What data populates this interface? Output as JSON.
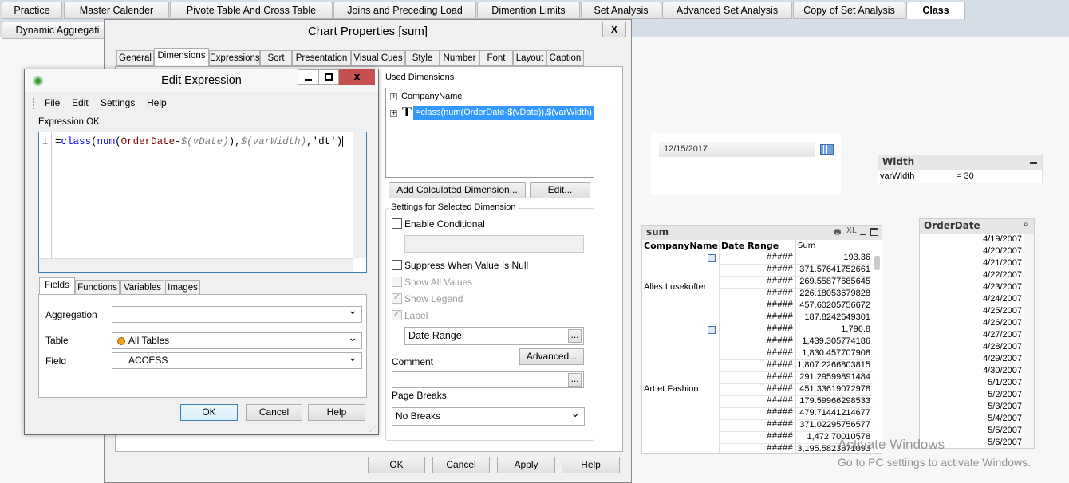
{
  "sheet_tabs": [
    "Practice",
    "Master Calender",
    "Pivote Table And Cross Table",
    "Joins and Preceding Load",
    "Dimention Limits",
    "Set Analysis",
    "Advanced Set Analysis",
    "Copy of Set Analysis",
    "Class"
  ],
  "sheet_tabs_row2": [
    "Dynamic Aggregati"
  ],
  "active_tab": "Class",
  "chart_properties": {
    "title": "Chart Properties [sum]",
    "close": "X",
    "tabs": [
      "General",
      "Dimensions",
      "Expressions",
      "Sort",
      "Presentation",
      "Visual Cues",
      "Style",
      "Number",
      "Font",
      "Layout",
      "Caption"
    ],
    "active_tab": "Dimensions",
    "used_dimensions_label": "Used Dimensions",
    "dimensions": [
      "CompanyName",
      "=class(num(OrderDate-$(vDate)),$(varWidth)"
    ],
    "add_calc_button": "Add Calculated Dimension...",
    "edit_button": "Edit...",
    "settings_group": "Settings for Selected Dimension",
    "enable_conditional": "Enable Conditional",
    "suppress_null": "Suppress When Value Is Null",
    "show_all_values": "Show All Values",
    "show_legend": "Show Legend",
    "label": "Label",
    "label_value": "Date Range",
    "ellipsis": "...",
    "advanced_button": "Advanced...",
    "comment_label": "Comment",
    "page_breaks_label": "Page Breaks",
    "page_breaks_value": "No Breaks",
    "ok": "OK",
    "cancel": "Cancel",
    "apply": "Apply",
    "help": "Help"
  },
  "edit_expression": {
    "title": "Edit Expression",
    "menu": [
      "File",
      "Edit",
      "Settings",
      "Help"
    ],
    "status": "Expression OK",
    "line_number": "1",
    "expression_parts": {
      "p1": "=",
      "p2": "class",
      "p3": "(",
      "p4": "num",
      "p5": "(",
      "p6": "OrderDate",
      "p7": "-",
      "p8": "$(vDate)",
      "p9": "),",
      "p10": "$(varWidth)",
      "p11": ",",
      "p12": "'dt'",
      "p13": ")"
    },
    "tabs": [
      "Fields",
      "Functions",
      "Variables",
      "Images"
    ],
    "aggregation_label": "Aggregation",
    "aggregation_value": "",
    "table_label": "Table",
    "table_value": "All Tables",
    "field_label": "Field",
    "field_value": "ACCESS",
    "ok": "OK",
    "cancel": "Cancel",
    "help": "Help"
  },
  "date_input": {
    "value": "12/15/2017"
  },
  "width_box": {
    "title": "Width",
    "var_name": "varWidth",
    "var_value": "= 30"
  },
  "sum_table": {
    "title": "sum",
    "xl": "XL",
    "columns": [
      "CompanyName",
      "Date Range",
      "Sum"
    ],
    "groups": [
      {
        "company": "Alles Lusekofter",
        "rows": [
          [
            "#####",
            "193.36"
          ],
          [
            "#####",
            "371.57641752661"
          ],
          [
            "#####",
            "269.55877685645"
          ],
          [
            "#####",
            "226.18053679828"
          ],
          [
            "#####",
            "457.60205756672"
          ],
          [
            "#####",
            "187.8242649301"
          ]
        ]
      },
      {
        "company": "Art et Fashion",
        "rows": [
          [
            "#####",
            "1,796.8"
          ],
          [
            "#####",
            "1,439.305774186"
          ],
          [
            "#####",
            "1,830.457707908"
          ],
          [
            "#####",
            "1,807.2266803815"
          ],
          [
            "#####",
            "291.29599891484"
          ],
          [
            "#####",
            "451.33619072978"
          ],
          [
            "#####",
            "179.59966298533"
          ],
          [
            "#####",
            "479.71441214677"
          ],
          [
            "#####",
            "371.02295756577"
          ],
          [
            "#####",
            "1,472.70010578"
          ],
          [
            "#####",
            "3,195.5823871093"
          ]
        ]
      }
    ]
  },
  "order_date": {
    "title": "OrderDate",
    "items": [
      "4/19/2007",
      "4/20/2007",
      "4/21/2007",
      "4/22/2007",
      "4/23/2007",
      "4/24/2007",
      "4/25/2007",
      "4/26/2007",
      "4/27/2007",
      "4/28/2007",
      "4/29/2007",
      "4/30/2007",
      "5/1/2007",
      "5/2/2007",
      "5/3/2007",
      "5/4/2007",
      "5/5/2007",
      "5/6/2007"
    ]
  },
  "watermark": {
    "line1": "Activate Windows",
    "line2": "Go to PC settings to activate Windows."
  },
  "colors": {
    "selection": "#3399ff",
    "close_red": "#c75050",
    "header_gray": "#e4e4e4"
  }
}
